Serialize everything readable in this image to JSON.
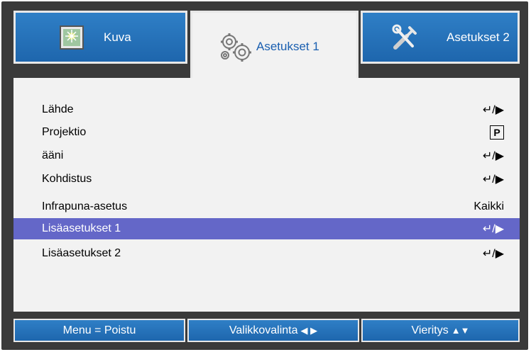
{
  "tabs": [
    {
      "label": "Kuva",
      "icon": "picture-icon",
      "active": false
    },
    {
      "label": "Asetukset 1",
      "icon": "gears-icon",
      "active": true
    },
    {
      "label": "Asetukset 2",
      "icon": "tools-icon",
      "active": false
    }
  ],
  "menu": {
    "items": [
      {
        "label": "Lähde",
        "value": "enter-right-icon"
      },
      {
        "label": "Projektio",
        "value": "P"
      },
      {
        "label": "ääni",
        "value": "enter-right-icon"
      },
      {
        "label": "Kohdistus",
        "value": "enter-right-icon"
      },
      {
        "label": "Infrapuna-asetus",
        "value": "Kaikki"
      },
      {
        "label": "Lisäasetukset 1",
        "value": "enter-right-icon",
        "selected": true
      },
      {
        "label": "Lisäasetukset 2",
        "value": "enter-right-icon"
      }
    ]
  },
  "footer": {
    "exit_label": "Menu = Poistu",
    "select_label": "Valikkovalinta",
    "scroll_label": "Vieritys"
  },
  "colors": {
    "tab_blue": "#1e66ad",
    "selected_row": "#6467c8",
    "panel_bg": "#f2f2f2",
    "frame": "#3a3a3a"
  }
}
